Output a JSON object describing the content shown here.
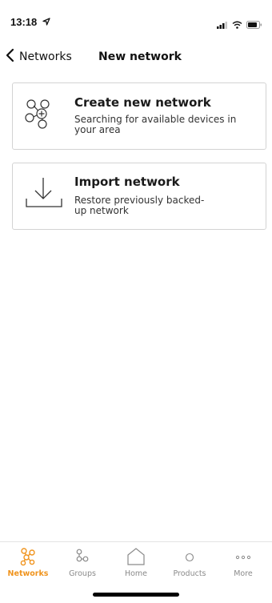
{
  "status_bar": {
    "time": "13:18",
    "icons": [
      "location-arrow-icon",
      "signal-icon",
      "wifi-icon",
      "battery-icon"
    ]
  },
  "nav": {
    "back_label": "Networks",
    "title": "New network"
  },
  "cards": [
    {
      "title": "Create new network",
      "description": "Searching for available devices in your area",
      "icon": "network-add-icon"
    },
    {
      "title": "Import network",
      "description": "Restore previously backed-up network",
      "icon": "download-icon"
    }
  ],
  "tabs": [
    {
      "label": "Networks",
      "icon": "networks-icon",
      "active": true
    },
    {
      "label": "Groups",
      "icon": "groups-icon",
      "active": false
    },
    {
      "label": "Home",
      "icon": "home-icon",
      "active": false
    },
    {
      "label": "Products",
      "icon": "products-icon",
      "active": false
    },
    {
      "label": "More",
      "icon": "more-icon",
      "active": false
    }
  ],
  "colors": {
    "accent": "#f0941e",
    "inactive_tab": "#8a8a8a",
    "card_border": "#d3d3d3"
  }
}
